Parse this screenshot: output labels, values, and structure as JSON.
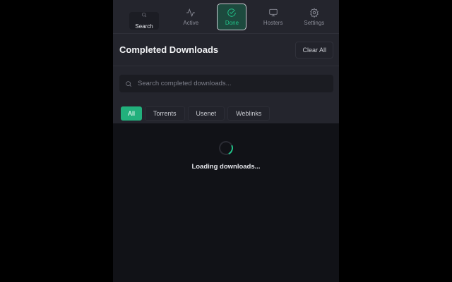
{
  "nav": {
    "items": [
      {
        "label": "Search",
        "icon": "search-icon"
      },
      {
        "label": "Active",
        "icon": "activity-icon"
      },
      {
        "label": "Done",
        "icon": "check-circle-icon"
      },
      {
        "label": "Hosters",
        "icon": "monitor-icon"
      },
      {
        "label": "Settings",
        "icon": "gear-icon"
      }
    ],
    "selected": "Done"
  },
  "header": {
    "title": "Completed Downloads",
    "clear_label": "Clear All"
  },
  "search": {
    "placeholder": "Search completed downloads...",
    "value": ""
  },
  "filters": {
    "items": [
      "All",
      "Torrents",
      "Usenet",
      "Weblinks"
    ],
    "selected": "All"
  },
  "status": {
    "loading_text": "Loading downloads..."
  },
  "colors": {
    "accent": "#22c58b"
  }
}
